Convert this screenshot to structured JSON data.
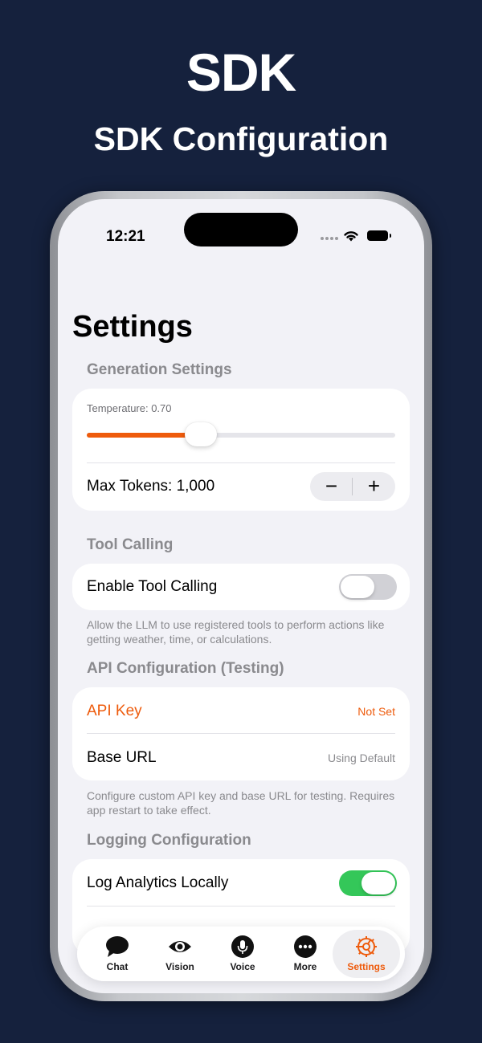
{
  "hero": {
    "title": "SDK",
    "subtitle": "SDK Configuration"
  },
  "status_bar": {
    "time": "12:21"
  },
  "page": {
    "title": "Settings"
  },
  "generation": {
    "header": "Generation Settings",
    "temperature_label": "Temperature: 0.70",
    "temperature_level": 0.35,
    "max_tokens_label": "Max Tokens: 1,000",
    "decrement": "−",
    "increment": "+"
  },
  "tool_calling": {
    "header": "Tool Calling",
    "toggle_label": "Enable Tool Calling",
    "enabled": false,
    "footnote": "Allow the LLM to use registered tools to perform actions like getting weather, time, or calculations."
  },
  "api": {
    "header": "API Configuration (Testing)",
    "key_label": "API Key",
    "key_value": "Not Set",
    "url_label": "Base URL",
    "url_value": "Using Default",
    "footnote": "Configure custom API key and base URL for testing. Requires app restart to take effect."
  },
  "logging": {
    "header": "Logging Configuration",
    "toggle_label": "Log Analytics Locally",
    "enabled": true
  },
  "tabs": [
    {
      "label": "Chat",
      "icon": "chat-bubble-icon"
    },
    {
      "label": "Vision",
      "icon": "eye-icon"
    },
    {
      "label": "Voice",
      "icon": "microphone-icon"
    },
    {
      "label": "More",
      "icon": "more-icon"
    },
    {
      "label": "Settings",
      "icon": "gear-icon",
      "active": true
    }
  ],
  "colors": {
    "accent": "#ee5b0c",
    "toggle_on": "#34c759",
    "toggle_off": "#d1d1d6",
    "background": "#15213d"
  }
}
